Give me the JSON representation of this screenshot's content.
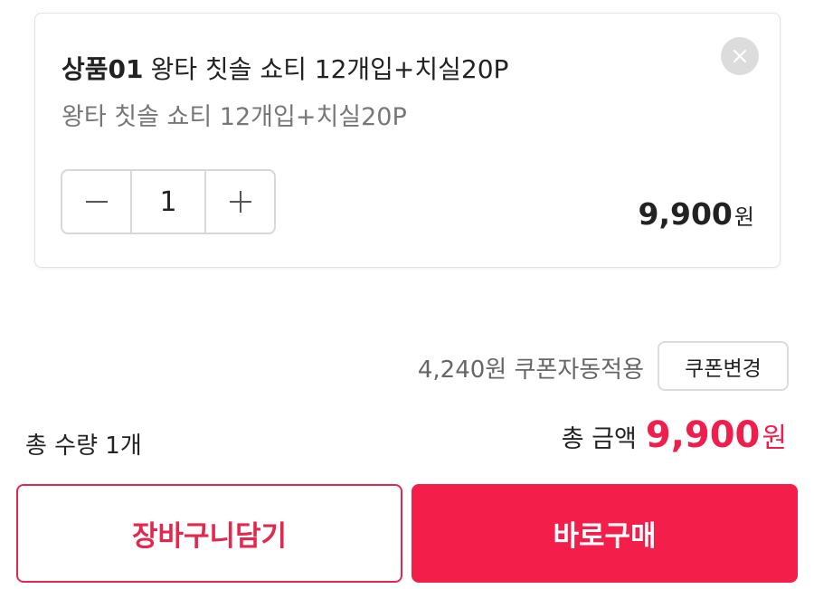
{
  "item": {
    "code": "상품01",
    "name": "왕타 칫솔 쇼티 12개입+치실20P",
    "option": "왕타 칫솔 쇼티 12개입+치실20P",
    "quantity": "1",
    "price": "9,900",
    "price_unit": "원",
    "icons": {
      "remove": "close-icon",
      "decrease": "minus-icon",
      "increase": "plus-icon"
    }
  },
  "coupon": {
    "text": "4,240원 쿠폰자동적용",
    "change_label": "쿠폰변경"
  },
  "summary": {
    "total_quantity": "총 수량 1개",
    "total_label": "총 금액",
    "total_amount": "9,900",
    "total_unit": "원"
  },
  "actions": {
    "cart_label": "장바구니담기",
    "buy_label": "바로구매"
  },
  "colors": {
    "accent": "#f41e4a",
    "accent_text": "#ef1e4c",
    "border": "#dcdcdc"
  }
}
